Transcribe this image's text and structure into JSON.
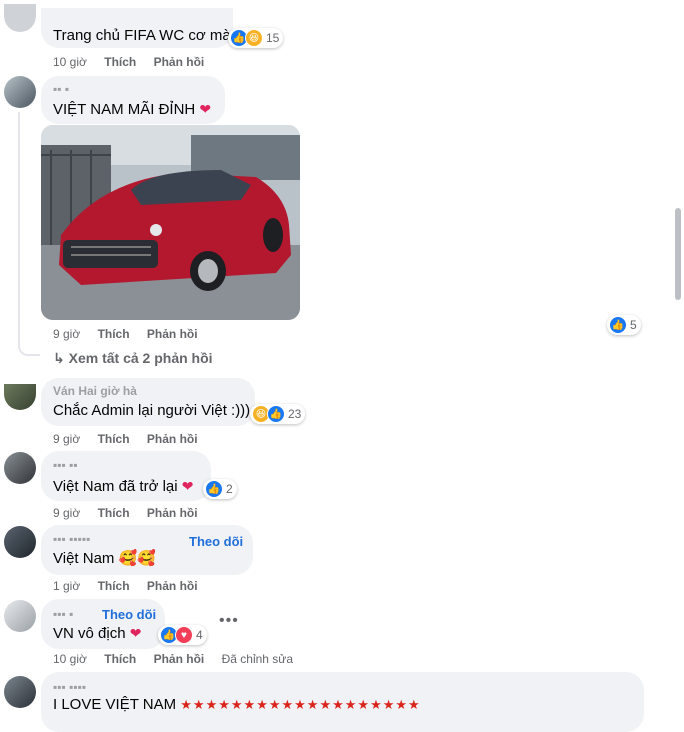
{
  "comments": [
    {
      "text": "Trang chủ FIFA WC cơ mà",
      "time": "10 giờ",
      "like_label": "Thích",
      "reply_label": "Phản hồi",
      "reactions": [
        "like-icon",
        "haha-icon"
      ],
      "reaction_count": "15"
    },
    {
      "text": "VIỆT NAM MÃI ĐỈNH",
      "time": "9 giờ",
      "like_label": "Thích",
      "reply_label": "Phản hồi",
      "reactions": [
        "like-icon"
      ],
      "reaction_count": "5",
      "has_photo": true,
      "view_replies": "Xem tất cả 2 phản hồi"
    },
    {
      "name_partial": "Ván Hai giờ hà",
      "text": "Chắc Admin lại người Việt :)))",
      "time": "9 giờ",
      "like_label": "Thích",
      "reply_label": "Phản hồi",
      "reactions": [
        "haha-icon",
        "like-icon"
      ],
      "reaction_count": "23"
    },
    {
      "text": "Việt Nam đã trở lại",
      "time": "9 giờ",
      "like_label": "Thích",
      "reply_label": "Phản hồi",
      "reactions": [
        "like-icon"
      ],
      "reaction_count": "2"
    },
    {
      "follow_label": "Theo dõi",
      "text": "Việt Nam",
      "time": "1 giờ",
      "like_label": "Thích",
      "reply_label": "Phản hồi"
    },
    {
      "follow_label": "Theo dõi",
      "text": "VN vô địch",
      "time": "10 giờ",
      "like_label": "Thích",
      "reply_label": "Phản hồi",
      "edited_label": "Đã chỉnh sửa",
      "reactions": [
        "like-icon",
        "love-icon"
      ],
      "reaction_count": "4"
    },
    {
      "text": "I LOVE VIỆT NAM"
    }
  ],
  "colors": {
    "bubble": "#f0f2f5",
    "like": "#1877f2",
    "heart": "#e0245e",
    "link": "#216fdb",
    "meta": "#65676b"
  }
}
